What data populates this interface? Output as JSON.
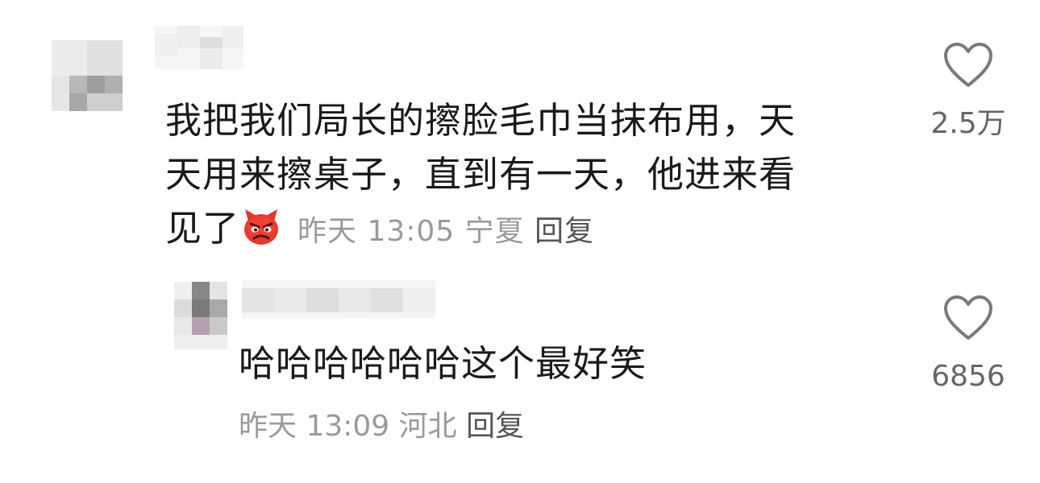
{
  "comments": [
    {
      "text_lines": [
        "我把我们局长的擦脸毛巾当抹布用，天",
        "天用来擦桌子，直到有一天，他进来看",
        "见了"
      ],
      "emoji": "angry-devil-emoji",
      "time": "昨天 13:05",
      "location": "宁夏",
      "reply_label": "回复",
      "likes": "2.5万"
    },
    {
      "text": "哈哈哈哈哈哈这个最好笑",
      "time": "昨天 13:09",
      "location": "河北",
      "reply_label": "回复",
      "likes": "6856"
    }
  ],
  "icons": {
    "like": "heart-outline-icon"
  },
  "colors": {
    "text": "#1a1a1a",
    "meta": "#9a9a9a",
    "reply": "#555555",
    "icon": "#7a7a7a"
  }
}
